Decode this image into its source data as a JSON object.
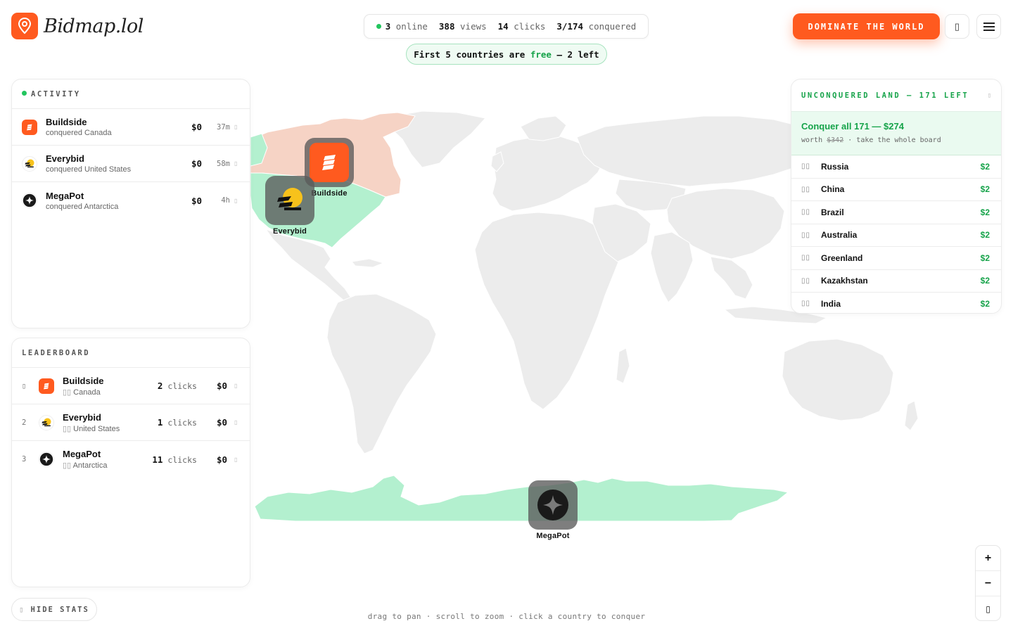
{
  "brand": {
    "name": "Bidmap.lol"
  },
  "stats": {
    "online_count": "3",
    "online_label": "online",
    "views_count": "388",
    "views_label": "views",
    "clicks_count": "14",
    "clicks_label": "clicks",
    "conquered_count": "3/174",
    "conquered_label": "conquered"
  },
  "free_banner": {
    "prefix": "First 5 countries are",
    "highlight": "free",
    "suffix": "– 2 left"
  },
  "header": {
    "cta_label": "DOMINATE THE WORLD",
    "icon_button_glyph": "▯",
    "menu_icon": "hamburger-icon"
  },
  "activity": {
    "title": "ACTIVITY",
    "items": [
      {
        "name": "Buildside",
        "action": "conquered Canada",
        "amount": "$0",
        "time": "37m"
      },
      {
        "name": "Everybid",
        "action": "conquered United States",
        "amount": "$0",
        "time": "58m"
      },
      {
        "name": "MegaPot",
        "action": "conquered Antarctica",
        "amount": "$0",
        "time": "4h"
      }
    ]
  },
  "leaderboard": {
    "title": "LEADERBOARD",
    "items": [
      {
        "rank": "▯",
        "name": "Buildside",
        "flag": "▯▯",
        "country": "Canada",
        "clicks": "2",
        "clicks_label": "clicks",
        "amount": "$0"
      },
      {
        "rank": "2",
        "name": "Everybid",
        "flag": "▯▯",
        "country": "United States",
        "clicks": "1",
        "clicks_label": "clicks",
        "amount": "$0"
      },
      {
        "rank": "3",
        "name": "MegaPot",
        "flag": "▯▯",
        "country": "Antarctica",
        "clicks": "11",
        "clicks_label": "clicks",
        "amount": "$0"
      }
    ]
  },
  "unconquered": {
    "title": "UNCONQUERED LAND – 171 LEFT",
    "toggle_glyph": "▯",
    "conquer_all": {
      "title": "Conquer all 171 — $274",
      "worth_prefix": "worth",
      "worth_original": "$342",
      "worth_suffix": "· take the whole board"
    },
    "countries": [
      {
        "flag": "▯▯",
        "name": "Russia",
        "price": "$2"
      },
      {
        "flag": "▯▯",
        "name": "China",
        "price": "$2"
      },
      {
        "flag": "▯▯",
        "name": "Brazil",
        "price": "$2"
      },
      {
        "flag": "▯▯",
        "name": "Australia",
        "price": "$2"
      },
      {
        "flag": "▯▯",
        "name": "Greenland",
        "price": "$2"
      },
      {
        "flag": "▯▯",
        "name": "Kazakhstan",
        "price": "$2"
      },
      {
        "flag": "▯▯",
        "name": "India",
        "price": "$2"
      }
    ]
  },
  "map": {
    "markers": [
      {
        "name": "Buildside",
        "territory": "Canada"
      },
      {
        "name": "Everybid",
        "territory": "United States"
      },
      {
        "name": "MegaPot",
        "territory": "Antarctica"
      }
    ],
    "colors": {
      "land": "#ececec",
      "owned_canada": "#f6d3c5",
      "owned_green": "#b3f0cf",
      "accent": "#ff5a1f",
      "success": "#16a34a"
    }
  },
  "controls": {
    "hide_stats_glyph": "▯",
    "hide_stats_label": "HIDE STATS",
    "hint": "drag to pan · scroll to zoom · click a country to conquer",
    "zoom_in": "+",
    "zoom_out": "−",
    "zoom_reset": "▯"
  }
}
